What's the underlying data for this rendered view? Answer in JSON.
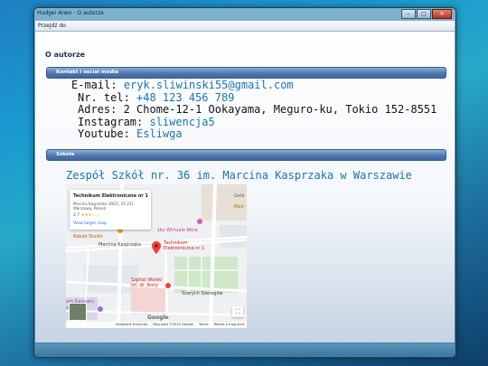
{
  "window": {
    "title": "Hudgei Arwo - O autorze",
    "minimize_glyph": "–",
    "maximize_glyph": "□",
    "close_glyph": "✕"
  },
  "menu": {
    "items": [
      "Przejdź do"
    ]
  },
  "page": {
    "title": "O autorze",
    "sections": {
      "contact_header": "Kontakt i social media",
      "school_header": "Szkoła"
    }
  },
  "contact": {
    "email_label": "E-mail:",
    "email_value": "eryk.sliwinski55@gmail.com",
    "phone_label": "Nr. tel:",
    "phone_value": "+48 123 456 789",
    "address_label": "Adres:",
    "address_value": "2 Chome-12-1 Ookayama, Meguro-ku, Tokio 152-8551",
    "instagram_label": "Instagram:",
    "instagram_value": "sliwencja5",
    "youtube_label": "Youtube:",
    "youtube_value": "Esliwga"
  },
  "school": {
    "name": "Zespół Szkół nr. 36 im. Marcina Kasprzaka w Warszawie",
    "map": {
      "place_name": "Technikum Elektroniczne nr 1",
      "place_address": "Marcina Kasprzaka 19/21, 01-211 Warszawa, Poland",
      "rating": "2.7",
      "rating_stars": "★★★☆☆",
      "view_larger": "View larger map",
      "street_label": "Marcina Kasprzaka",
      "pin_label": "Technikum Elektroniczne nr 1",
      "poi_1": "Kebab Studio",
      "poi_2": "ško Wirtuale Wola",
      "poi_3": "Szpital Wolski im. dr. Anny",
      "poi_4": "Szarych Szeregów",
      "poi_5": "Geib",
      "poi_6": "Rico",
      "poi_7": "um Gazowni",
      "poi_8": "orda",
      "google_logo": "Google",
      "attr_shortcuts": "Keyboard shortcuts",
      "attr_data": "Map data ©2025 Google",
      "attr_terms": "Terms",
      "attr_report": "Report a map error",
      "fullscreen_glyph": "⛶",
      "colors": {
        "road": "#ffffff",
        "park": "#cfe8c9",
        "pin": "#ea4335",
        "building": "#e8dfd6"
      }
    }
  }
}
